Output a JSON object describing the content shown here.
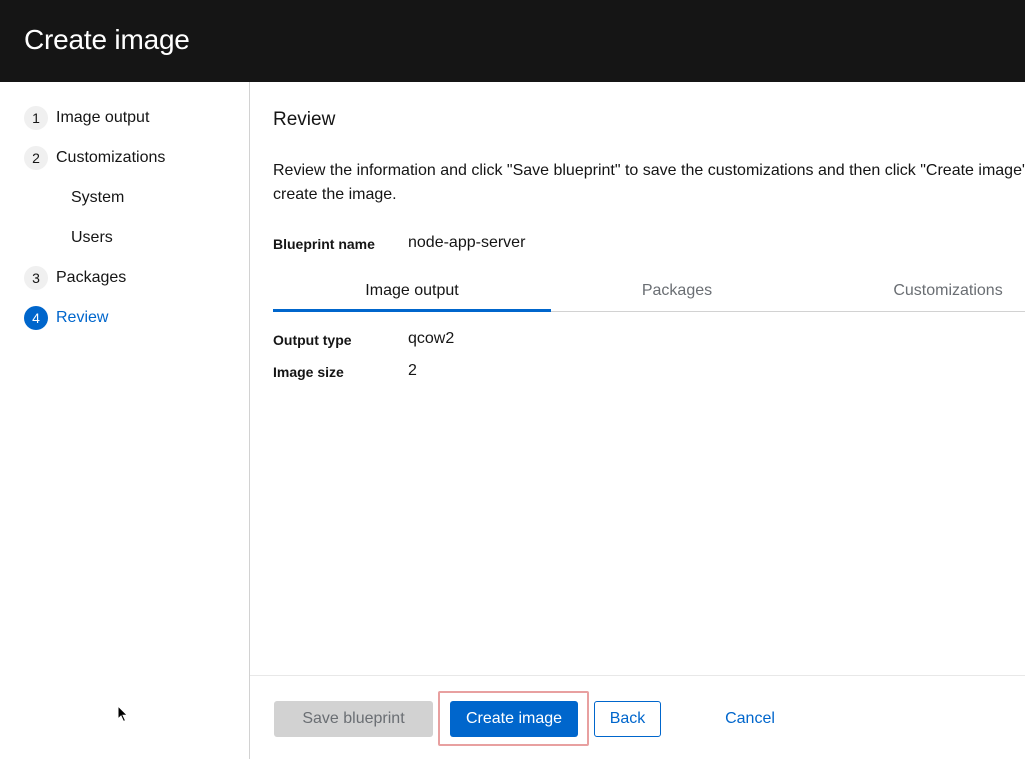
{
  "header": {
    "title": "Create image"
  },
  "nav": {
    "steps": [
      {
        "num": "1",
        "label": "Image output"
      },
      {
        "num": "2",
        "label": "Customizations"
      },
      {
        "num": "3",
        "label": "Packages"
      },
      {
        "num": "4",
        "label": "Review"
      }
    ],
    "sub_items": [
      "System",
      "Users"
    ]
  },
  "review": {
    "title": "Review",
    "description": "Review the information and click \"Save blueprint\" to save the customizations and then click \"Create image\" to create the image.",
    "blueprint_label": "Blueprint name",
    "blueprint_value": "node-app-server",
    "tabs": [
      "Image output",
      "Packages",
      "Customizations"
    ],
    "output_type_label": "Output type",
    "output_type_value": "qcow2",
    "image_size_label": "Image size",
    "image_size_value": "2"
  },
  "footer": {
    "save_label": "Save blueprint",
    "create_label": "Create image",
    "back_label": "Back",
    "cancel_label": "Cancel"
  },
  "colors": {
    "accent": "#0066cc",
    "header_bg": "#151515",
    "highlight": "#e8a0a0"
  }
}
